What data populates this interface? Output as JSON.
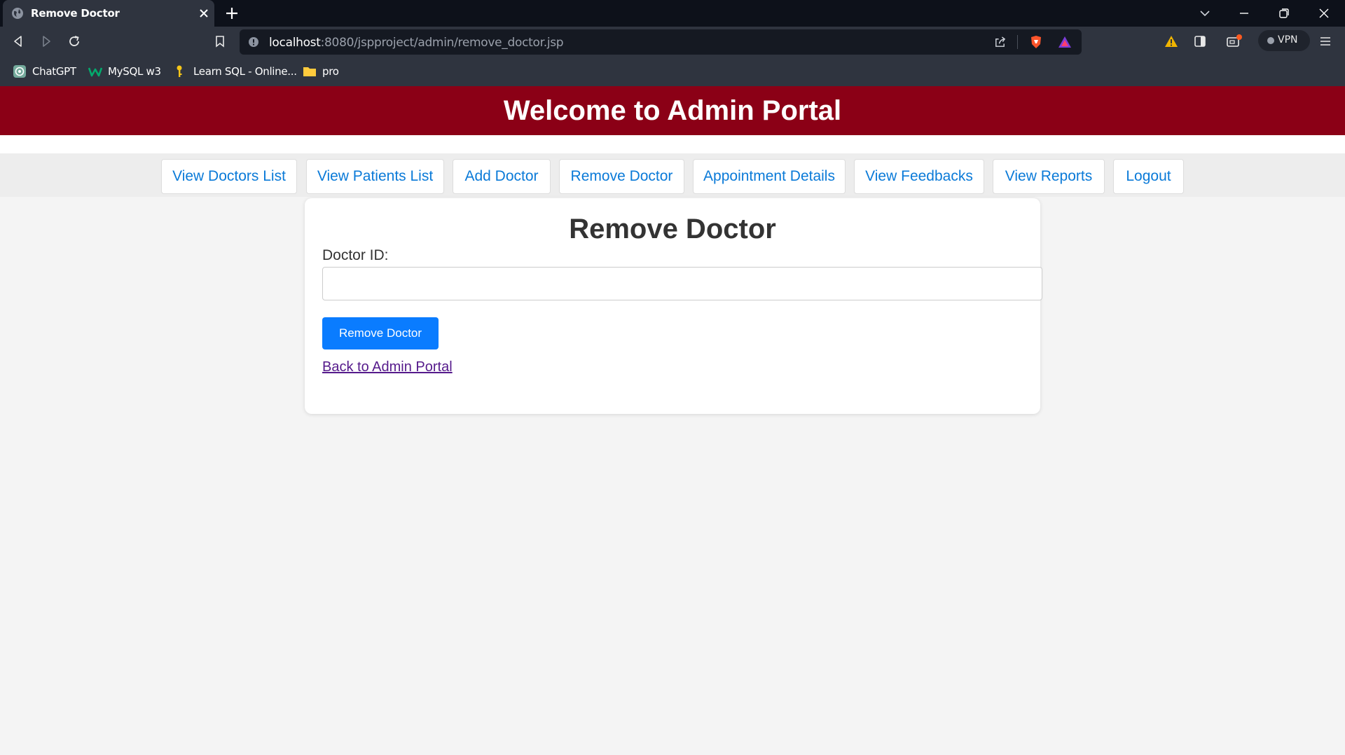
{
  "browser": {
    "tab": {
      "title": "Remove Doctor"
    },
    "url": {
      "host": "localhost",
      "rest": ":8080/jspproject/admin/remove_doctor.jsp"
    },
    "vpn_label": "VPN",
    "bookmarks": [
      {
        "label": "ChatGPT",
        "icon": "chatgpt-icon"
      },
      {
        "label": "MySQL w3",
        "icon": "w3schools-icon"
      },
      {
        "label": "Learn SQL - Online...",
        "icon": "key-icon"
      },
      {
        "label": "pro",
        "icon": "folder-icon"
      }
    ]
  },
  "header": {
    "title": "Welcome to Admin Portal"
  },
  "nav": {
    "items": [
      "View Doctors List",
      "View Patients List",
      "Add Doctor",
      "Remove Doctor",
      "Appointment Details",
      "View Feedbacks",
      "View Reports",
      "Logout"
    ]
  },
  "form": {
    "title": "Remove Doctor",
    "doctor_id_label": "Doctor ID:",
    "doctor_id_value": "",
    "submit_label": "Remove Doctor",
    "back_link": "Back to Admin Portal"
  },
  "colors": {
    "header_bg": "#8b0016",
    "nav_link": "#0a7ad8",
    "primary_button": "#0a7cff",
    "visited_link": "#551a8b"
  }
}
